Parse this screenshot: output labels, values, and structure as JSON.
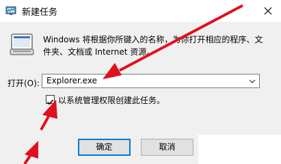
{
  "window": {
    "title": "新建任务",
    "close_glyph": "×"
  },
  "dialog": {
    "description": "Windows 将根据你所键入的名称，为你打开相应的程序、文件夹、文档或 Internet 资源。",
    "open_label": "打开(O):",
    "combo_value": "Explorer.exe",
    "checkbox_label": "以系统管理权限创建此任务。",
    "checkbox_checked": true
  },
  "buttons": {
    "ok": "确定",
    "cancel": "取消"
  },
  "annotation": {
    "arrow_color": "#e0101e"
  }
}
